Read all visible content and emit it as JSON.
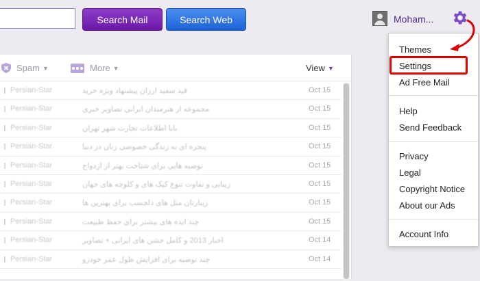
{
  "toolbar": {
    "search_mail_label": "Search Mail",
    "search_web_label": "Search Web",
    "user_name": "Moham..."
  },
  "list_toolbar": {
    "spam_label": "Spam",
    "more_label": "More",
    "view_label": "View"
  },
  "messages": [
    {
      "sender": "Persian-Star",
      "subject": "قید سفید ارزان پیشنهاد ویژه خرید",
      "date": "Oct 15"
    },
    {
      "sender": "Persian-Star",
      "subject": "مجموعه از هنرمندان ایرانی تصاویر خبری",
      "date": "Oct 15"
    },
    {
      "sender": "Persian-Star",
      "subject": "بابا اطلاعات تجارت شهر تهران",
      "date": "Oct 15"
    },
    {
      "sender": "Persian-Star",
      "subject": "پنجره ای به زندگی خصوصی زنان در دنیا",
      "date": "Oct 15"
    },
    {
      "sender": "Persian-Star",
      "subject": "توصیه هایی برای شناخت بهتر از ازدواج",
      "date": "Oct 15"
    },
    {
      "sender": "Persian-Star",
      "subject": "زیبایی و تفاوت تنوع کیک های و کلوچه های جهان",
      "date": "Oct 15"
    },
    {
      "sender": "Persian-Star",
      "subject": "زیبارتان مثل های دلچسب برای بهترین ها",
      "date": "Oct 15"
    },
    {
      "sender": "Persian-Star",
      "subject": "چند ایده های بیشتر برای حفظ طبیعت",
      "date": "Oct 15"
    },
    {
      "sender": "Persian-Star",
      "subject": "اخبار 2013 و کامل جشن های ایرانی + تصاویر",
      "date": "Oct 14"
    },
    {
      "sender": "Persian-Star",
      "subject": "چند توصیه برای افزایش طول عمر خودرو",
      "date": "Oct 14"
    }
  ],
  "settings_menu": {
    "items": [
      "Themes",
      "Settings",
      "Ad Free Mail",
      "Help",
      "Send Feedback",
      "Privacy",
      "Legal",
      "Copyright Notice",
      "About our Ads",
      "Account Info"
    ]
  },
  "colors": {
    "accent_purple": "#6b17a8",
    "accent_blue": "#1d62d6",
    "highlight_red": "#e10000"
  }
}
